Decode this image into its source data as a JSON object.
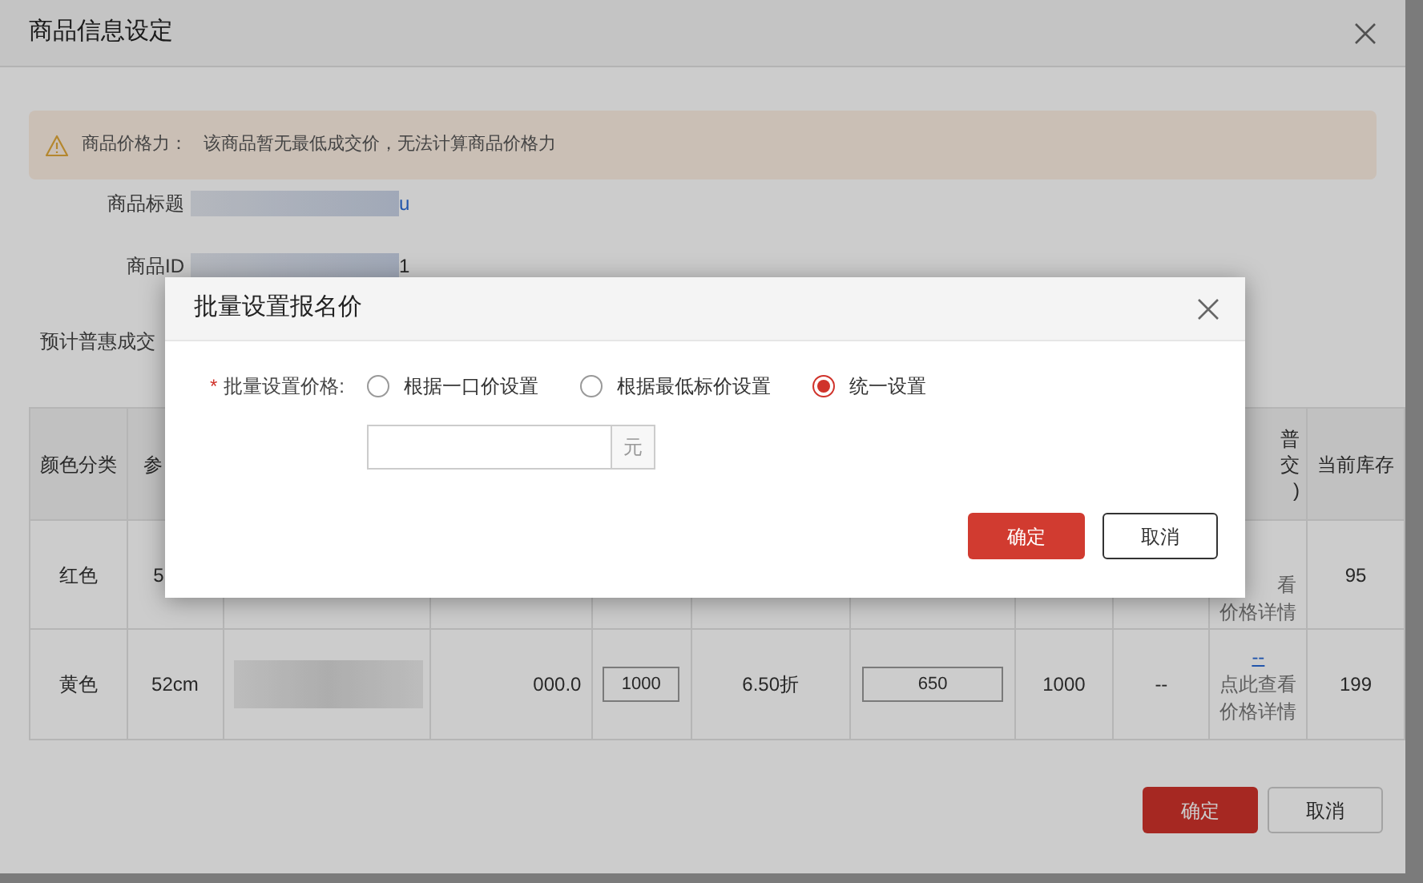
{
  "dialog": {
    "title": "商品信息设定"
  },
  "alert": {
    "label": "商品价格力：",
    "message": "该商品暂无最低成交价，无法计算商品价格力"
  },
  "fields": [
    {
      "label": "商品标题",
      "kind": "link",
      "value": "u"
    },
    {
      "label": "商品ID",
      "kind": "text",
      "value": "1"
    },
    {
      "label": "预计普惠成交",
      "kind": "covered"
    }
  ],
  "table": {
    "columns": {
      "column_1": "颜色分类",
      "column_2": "参",
      "column_10": [
        "普",
        "交",
        ")"
      ],
      "column_11": "当前库存"
    },
    "rows": [
      {
        "column_1": "红色",
        "column_2": "5",
        "column_10": {
          "kind": "detail",
          "lines": [
            "看",
            "价格详情"
          ]
        },
        "column_11": "95"
      },
      {
        "column_1": "黄色",
        "column_2": "52cm",
        "column_3": {
          "kind": "redacted"
        },
        "column_4": "000.0",
        "column_5": {
          "kind": "input",
          "value": "1000"
        },
        "column_6": "6.50折",
        "column_7": {
          "kind": "input",
          "value": "650"
        },
        "column_8": "1000",
        "column_9": "--",
        "column_10": {
          "kind": "detail",
          "link": "--",
          "lines": [
            "点此查看",
            "价格详情"
          ]
        },
        "column_11": "199"
      }
    ]
  },
  "footer_buttons": [
    {
      "label": "确定",
      "kind": "primary"
    },
    {
      "label": "取消",
      "kind": "default"
    }
  ],
  "modal": {
    "title": "批量设置报名价",
    "required_mark": "*",
    "label": "批量设置价格:",
    "options": [
      {
        "label": "根据一口价设置",
        "selected": false
      },
      {
        "label": "根据最低标价设置",
        "selected": false
      },
      {
        "label": "统一设置",
        "selected": true
      }
    ],
    "input": {
      "suffix": "元"
    },
    "buttons": [
      {
        "label": "确定",
        "kind": "primary"
      },
      {
        "label": "取消",
        "kind": "default"
      }
    ]
  }
}
